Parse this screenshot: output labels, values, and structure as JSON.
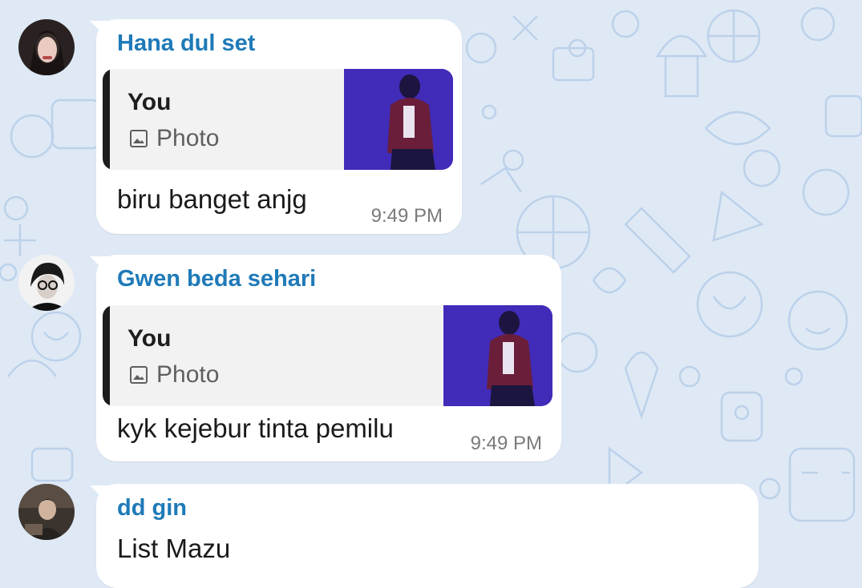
{
  "wallpaper": {
    "background": "#dfe9f5",
    "pattern_color": "#b9cfe9"
  },
  "messages": [
    {
      "sender": "Hana dul set",
      "avatar": "avatar-hana",
      "reply": {
        "author": "You",
        "type": "Photo"
      },
      "text": "biru banget anjg",
      "time": "9:49 PM"
    },
    {
      "sender": "Gwen beda sehari",
      "avatar": "avatar-gwen",
      "reply": {
        "author": "You",
        "type": "Photo"
      },
      "text": "kyk kejebur tinta pemilu",
      "time": "9:49 PM"
    },
    {
      "sender": "dd gin",
      "avatar": "avatar-ddgin",
      "text": "List Mazu"
    }
  ],
  "colors": {
    "sender_name": "#1f7ab8",
    "photo_tint": "#4b34c9"
  }
}
